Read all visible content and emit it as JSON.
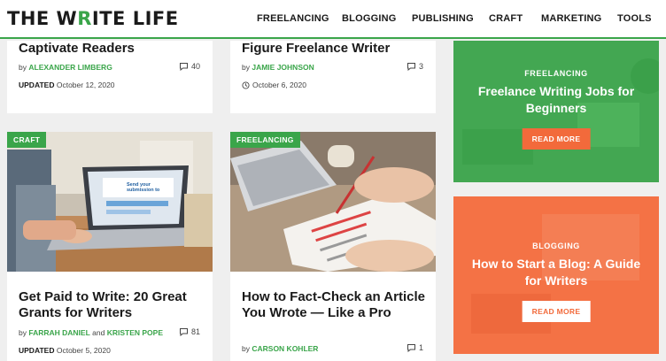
{
  "header": {
    "logo_prefix": "THE W",
    "logo_accent": "R",
    "logo_rest": "ITE LIFE",
    "nav": [
      "FREELANCING",
      "BLOGGING",
      "PUBLISHING",
      "CRAFT",
      "MARKETING",
      "TOOLS"
    ]
  },
  "cards": [
    {
      "title": "Captivate Readers",
      "by": "by",
      "author": "ALEXANDER LIMBERG",
      "comments": "40",
      "updated_label": "UPDATED",
      "date": "October 12, 2020"
    },
    {
      "title": "Figure Freelance Writer",
      "by": "by",
      "author": "JAMIE JOHNSON",
      "comments": "3",
      "date": "October 6, 2020"
    },
    {
      "badge": "CRAFT",
      "title": "Get Paid to Write: 20 Great Grants for Writers",
      "by": "by",
      "author": "FARRAH DANIEL",
      "and": "and",
      "author2": "KRISTEN POPE",
      "comments": "81",
      "updated_label": "UPDATED",
      "date": "October 5, 2020",
      "screen_text": "Send your submission to"
    },
    {
      "badge": "FREELANCING",
      "title": "How to Fact-Check an Article You Wrote — Like a Pro",
      "by": "by",
      "author": "CARSON KOHLER",
      "comments": "1"
    }
  ],
  "promos": [
    {
      "category": "FREELANCING",
      "title": "Freelance Writing Jobs for Beginners",
      "button": "READ MORE",
      "color": "#3aa54a"
    },
    {
      "category": "BLOGGING",
      "title": "How to Start a Blog: A Guide for Writers",
      "button": "READ MORE",
      "color": "#f26a3b"
    }
  ]
}
